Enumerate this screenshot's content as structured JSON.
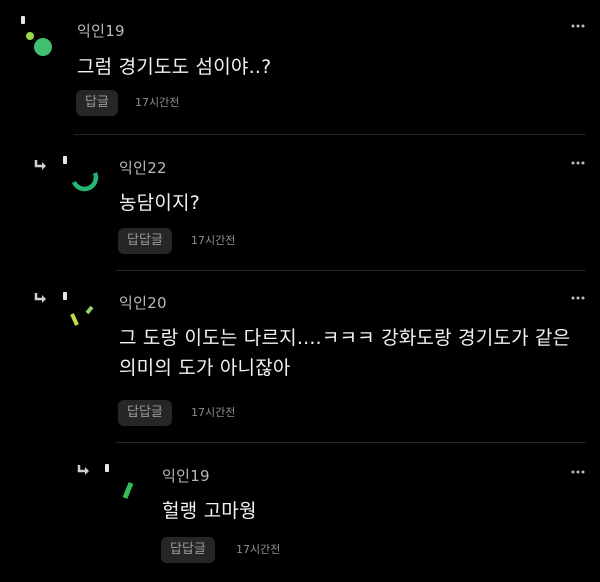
{
  "comments": [
    {
      "author": "익인19",
      "text": "그럼 경기도도 섬이야..?",
      "reply_label": "답글",
      "time": "17시간전",
      "avatar_color": "#3fbf6f",
      "is_reply": false
    },
    {
      "author": "익인22",
      "text": "농담이지?",
      "reply_label": "답답글",
      "time": "17시간전",
      "avatar_color": "#22b573",
      "is_reply": true
    },
    {
      "author": "익인20",
      "text": "그 도랑 이도는 다르지....ㅋㅋㅋ 강화도랑 경기도가 같은 의미의 도가 아니잖아",
      "reply_label": "답답글",
      "time": "17시간전",
      "avatar_color": "#c8d84a",
      "is_reply": true
    },
    {
      "author": "익인19",
      "text": "헐랭 고마웡",
      "reply_label": "답답글",
      "time": "17시간전",
      "avatar_color": "#2fbf55",
      "is_reply": true
    }
  ],
  "icons": {
    "reply_arrow": "reply-arrow-icon",
    "more": "more-options-icon",
    "badge": "user-badge-icon"
  }
}
